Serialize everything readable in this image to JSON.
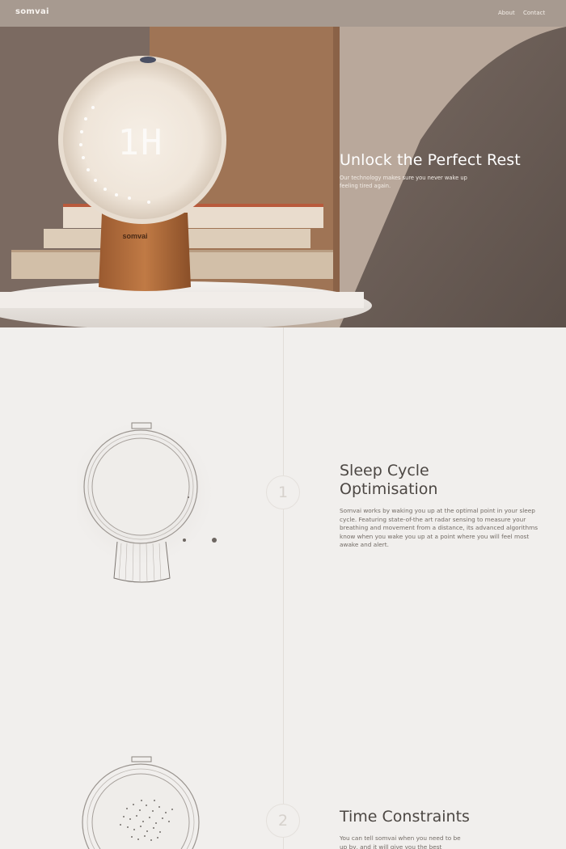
{
  "nav": {
    "logo": "somvai",
    "links": [
      "About",
      "Contact"
    ]
  },
  "hero": {
    "title": "Unlock the Perfect Rest",
    "subtitle": "Our technology makes sure you never wake up feeling tired again.",
    "device_display": "1H",
    "device_brand": "somvai"
  },
  "features": [
    {
      "number": "1",
      "title_line1": "Sleep Cycle",
      "title_line2": "Optimisation",
      "body": "Somvai works by waking you up at the optimal point in your sleep cycle. Featuring state-of-the art radar sensing to measure your breathing and movement from a distance, its advanced algorithms know when you wake you up at a point where you will feel most awake and alert."
    },
    {
      "number": "2",
      "title_line1": "Time Constraints",
      "title_line2": "",
      "body": "You can tell somvai when you need to be up by, and it will give you the best"
    }
  ],
  "colors": {
    "nav_bg": "#a79a90",
    "page_bg": "#f1efed",
    "heading": "#4c4743",
    "body_text": "#726b65"
  }
}
